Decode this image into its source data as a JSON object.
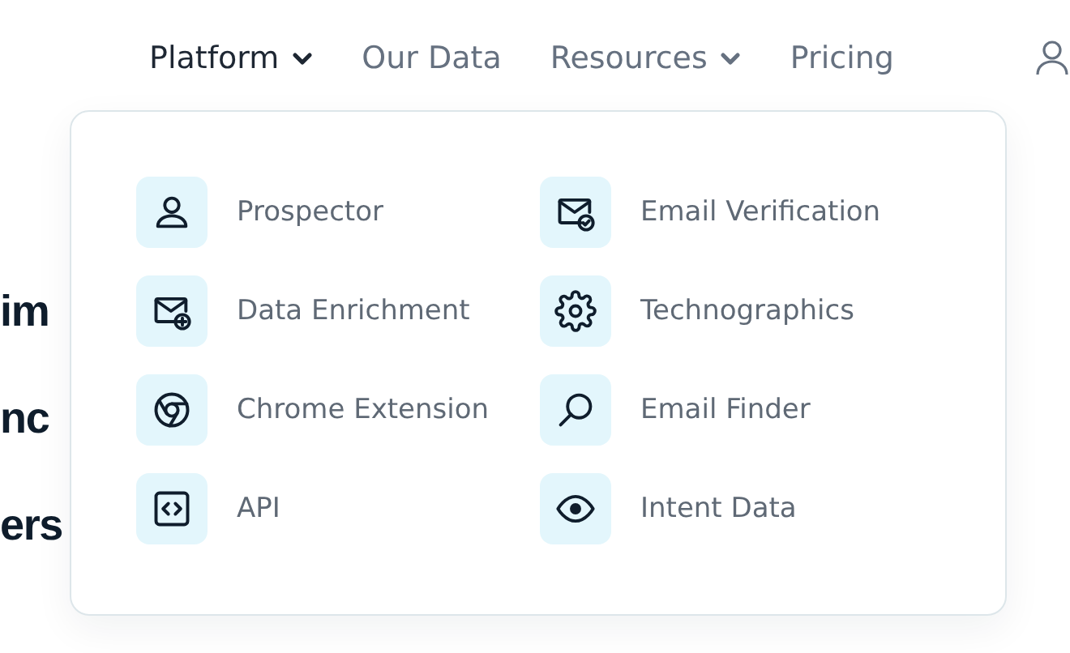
{
  "nav": [
    {
      "label": "Platform",
      "selected": true,
      "dropdown": true
    },
    {
      "label": "Our Data",
      "selected": false,
      "dropdown": false
    },
    {
      "label": "Resources",
      "selected": false,
      "dropdown": true
    },
    {
      "label": "Pricing",
      "selected": false,
      "dropdown": false
    }
  ],
  "hero_heading_fragments": [
    "im",
    "nc",
    "ers"
  ],
  "platform_menu": {
    "columns": [
      [
        {
          "label": "Prospector"
        },
        {
          "label": "Data Enrichment"
        },
        {
          "label": "Chrome Extension"
        },
        {
          "label": "API"
        }
      ],
      [
        {
          "label": "Email Verification"
        },
        {
          "label": "Technographics"
        },
        {
          "label": "Email Finder"
        },
        {
          "label": "Intent Data"
        }
      ]
    ]
  }
}
